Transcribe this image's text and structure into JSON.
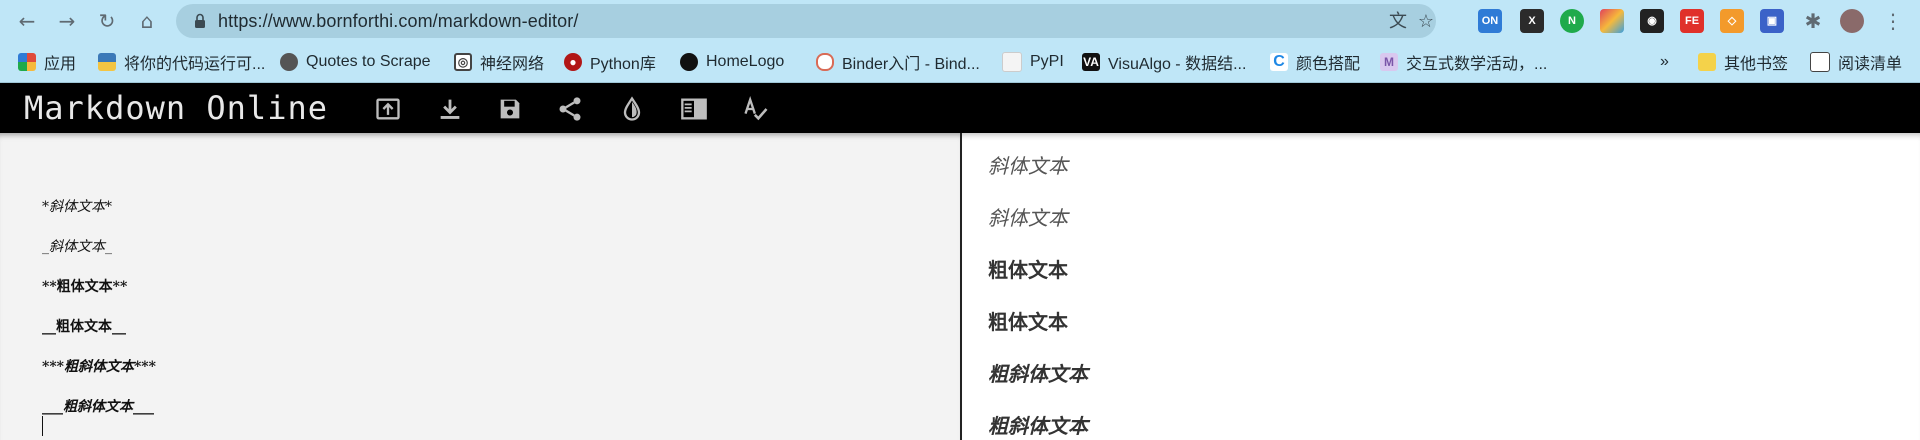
{
  "browser": {
    "url": "https://www.bornforthi.com/markdown-editor/",
    "extensions": [
      {
        "name": "on-extension-icon",
        "label": "ON",
        "color": "#2f7bd6"
      },
      {
        "name": "x-extension-icon",
        "label": "X",
        "color": "#2b2b2b"
      },
      {
        "name": "n-extension-icon",
        "label": "N",
        "color": "#1faa4b"
      },
      {
        "name": "grid-extension-icon",
        "label": "",
        "color": "#e0425b"
      },
      {
        "name": "mask-extension-icon",
        "label": "",
        "color": "#222"
      },
      {
        "name": "fe-extension-icon",
        "label": "FE",
        "color": "#e0312a"
      },
      {
        "name": "cube-extension-icon",
        "label": "",
        "color": "#f39a2b"
      },
      {
        "name": "save-extension-icon",
        "label": "",
        "color": "#3b62c8"
      }
    ]
  },
  "bookmarks": [
    {
      "label": "应用",
      "icon": "apps-grid-icon",
      "color": "#e04a3a"
    },
    {
      "label": "将你的代码运行可...",
      "icon": "python-icon",
      "color": "#3b79b8"
    },
    {
      "label": "Quotes to Scrape",
      "icon": "globe-icon",
      "color": "#555"
    },
    {
      "label": "神经网络",
      "icon": "spiral-icon",
      "color": "#444"
    },
    {
      "label": "Python库",
      "icon": "python-red-icon",
      "color": "#b11616"
    },
    {
      "label": "HomeLogo",
      "icon": "github-icon",
      "color": "#111"
    },
    {
      "label": "Binder入门 - Bind...",
      "icon": "binder-icon",
      "color": "#d96b56"
    },
    {
      "label": "PyPI",
      "icon": "cube-icon",
      "color": "#e0e0e0"
    },
    {
      "label": "VisuAlgo - 数据结...",
      "icon": "visualgo-icon",
      "color": "#111"
    },
    {
      "label": "颜色搭配",
      "icon": "c-icon",
      "color": "#1e88e5"
    },
    {
      "label": "交互式数学活动，...",
      "icon": "math-icon",
      "color": "#7a55a8"
    }
  ],
  "bookmarks_right": {
    "overflow": "»",
    "other": "其他书签",
    "reading": "阅读清单"
  },
  "app": {
    "title": "Markdown Online",
    "toolbar_icons": [
      "open-file-icon",
      "download-icon",
      "save-icon",
      "share-icon",
      "contrast-icon",
      "preview-toggle-icon",
      "spellcheck-icon"
    ]
  },
  "editor": {
    "lines": [
      "*斜体文本*",
      "_斜体文本_",
      "**粗体文本**",
      "__粗体文本__",
      "***粗斜体文本***",
      "___粗斜体文本___"
    ]
  },
  "preview": {
    "lines": [
      "斜体文本",
      "斜体文本",
      "粗体文本",
      "粗体文本",
      "粗斜体文本",
      "粗斜体文本"
    ]
  }
}
